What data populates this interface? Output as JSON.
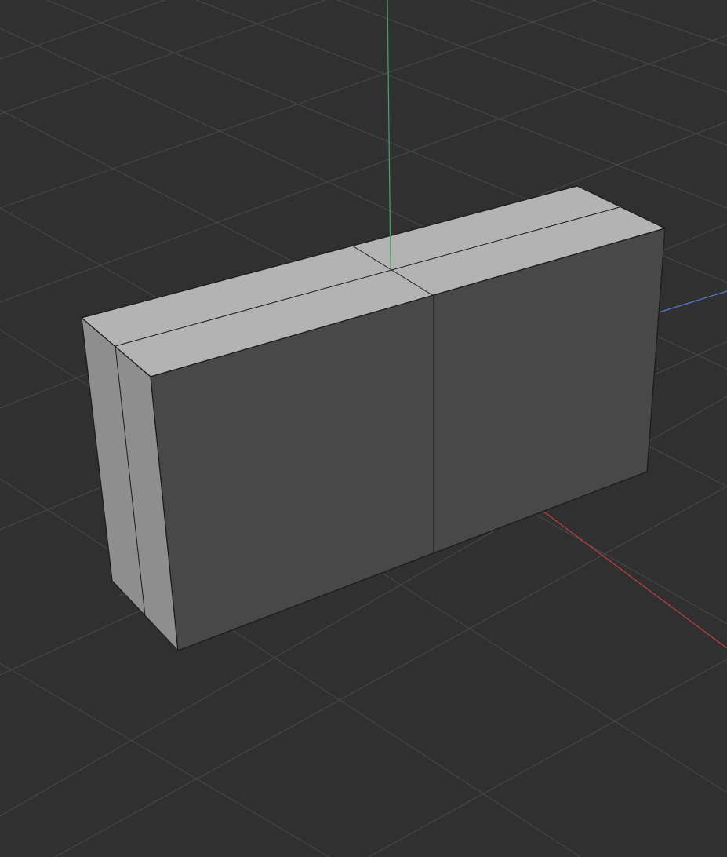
{
  "viewport": {
    "background_color": "#303030",
    "grid_color": "#494949",
    "axis_colors": {
      "x_axis": "#c04040",
      "y_axis": "#4f7fd0",
      "z_axis": "#3fa86a"
    },
    "shading": {
      "top_face": "#b3b3b3",
      "side_face": "#8e8e8e",
      "front_face": "#484848",
      "edge": "#1a1a1a"
    },
    "object": {
      "shape": "box",
      "visible_faces": [
        "top",
        "left-side",
        "front"
      ],
      "edge_loops": 2
    },
    "grid_visible": true
  }
}
